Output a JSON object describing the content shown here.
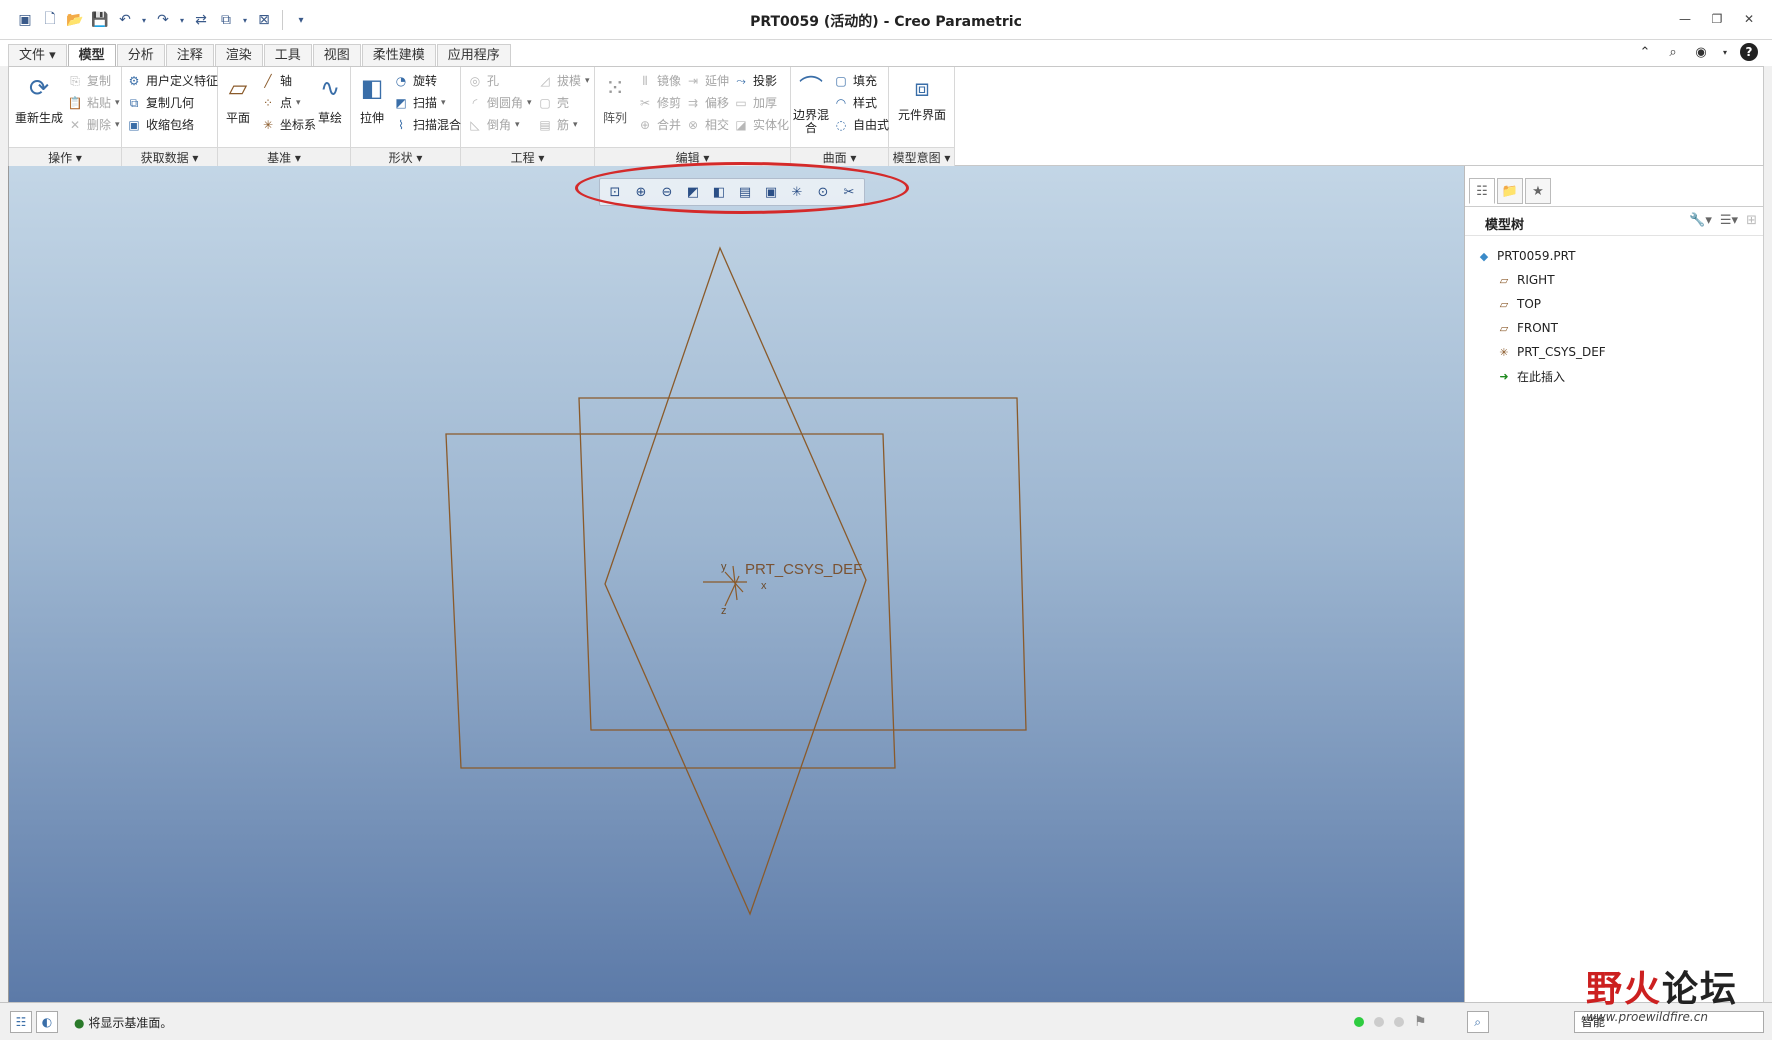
{
  "window": {
    "title": "PRT0059 (活动的) - Creo Parametric"
  },
  "tabs": [
    {
      "label": "文件 ▾"
    },
    {
      "label": "模型"
    },
    {
      "label": "分析"
    },
    {
      "label": "注释"
    },
    {
      "label": "渲染"
    },
    {
      "label": "工具"
    },
    {
      "label": "视图"
    },
    {
      "label": "柔性建模"
    },
    {
      "label": "应用程序"
    }
  ],
  "ribbon": {
    "operations": {
      "footer": "操作 ▾",
      "regenerate": "重新生成",
      "copy": "复制",
      "paste": "粘贴",
      "delete": "删除"
    },
    "get_data": {
      "footer": "获取数据 ▾",
      "udf": "用户定义特征",
      "copy_geom": "复制几何",
      "shrinkwrap": "收缩包络"
    },
    "datum": {
      "footer": "基准 ▾",
      "plane": "平面",
      "axis": "轴",
      "point": "点",
      "csys": "坐标系",
      "sketch": "草绘"
    },
    "shapes": {
      "footer": "形状 ▾",
      "extrude": "拉伸",
      "revolve": "旋转",
      "sweep": "扫描",
      "swept_blend": "扫描混合"
    },
    "engineering": {
      "footer": "工程 ▾",
      "hole": "孔",
      "draft": "拔模",
      "round": "倒圆角",
      "shell": "壳",
      "chamfer": "倒角",
      "rib": "筋"
    },
    "editing": {
      "footer": "编辑 ▾",
      "pattern": "阵列",
      "mirror": "镜像",
      "extend": "延伸",
      "project": "投影",
      "trim": "修剪",
      "offset": "偏移",
      "thicken": "加厚",
      "merge": "合并",
      "intersect": "相交",
      "solidify": "实体化"
    },
    "surfaces": {
      "footer": "曲面 ▾",
      "boundary_blend": "边界混合",
      "fill": "填充",
      "style": "样式",
      "freestyle": "自由式"
    },
    "model_intent": {
      "footer": "模型意图 ▾",
      "component_interface": "元件界面"
    }
  },
  "viewport": {
    "csys_label": "PRT_CSYS_DEF",
    "axis_x": "x",
    "axis_y": "y",
    "axis_z": "z"
  },
  "model_tree": {
    "title": "模型树",
    "items": [
      {
        "label": "PRT0059.PRT"
      },
      {
        "label": "RIGHT"
      },
      {
        "label": "TOP"
      },
      {
        "label": "FRONT"
      },
      {
        "label": "PRT_CSYS_DEF"
      },
      {
        "label": "在此插入"
      }
    ]
  },
  "status": {
    "message": "将显示基准面。",
    "filter": "智能"
  },
  "watermark": {
    "brand_a": "野火",
    "brand_b": "论坛",
    "url": "www.proewildfire.cn"
  },
  "colors": {
    "datum_plane": "#8a5a2a",
    "highlight_ring": "#d42a2a",
    "viewport_top": "#c3d6e6",
    "viewport_bottom": "#5c7aa8"
  }
}
